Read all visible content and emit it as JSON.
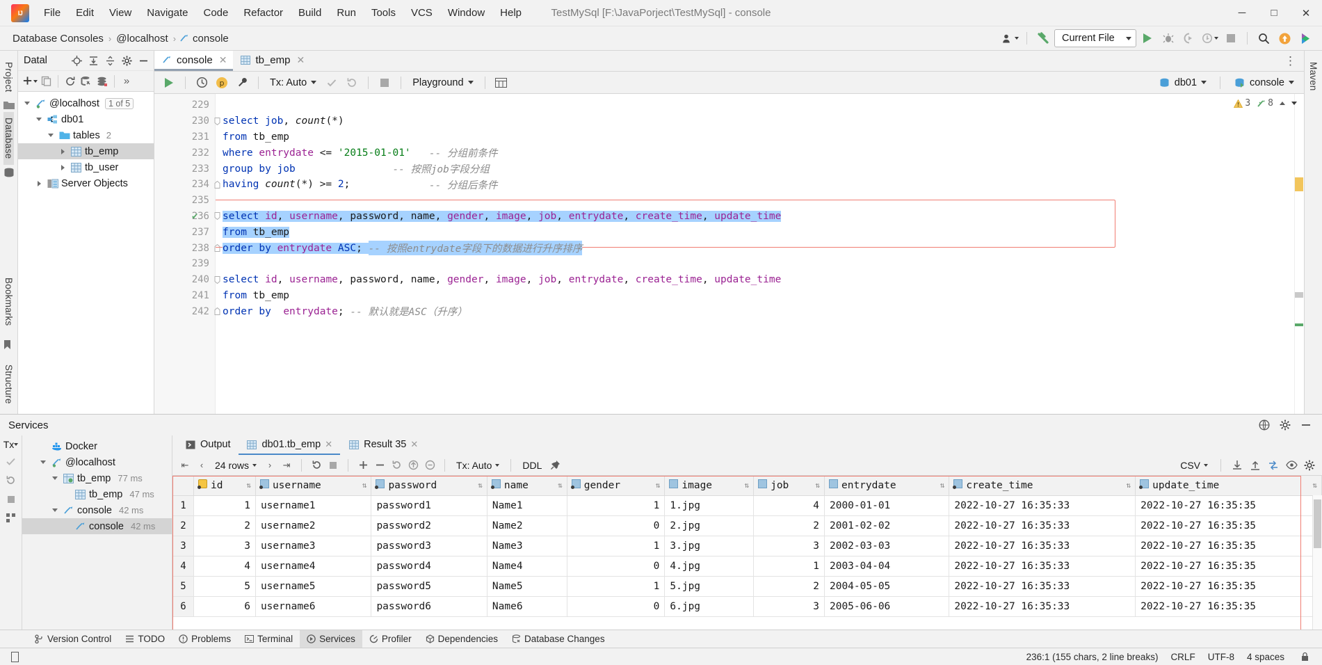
{
  "window": {
    "title": "TestMySql [F:\\JavaPorject\\TestMySql] - console",
    "minimize": "─",
    "maximize": "□",
    "close": "✕"
  },
  "menu": [
    {
      "label": "File"
    },
    {
      "label": "Edit"
    },
    {
      "label": "View"
    },
    {
      "label": "Navigate"
    },
    {
      "label": "Code"
    },
    {
      "label": "Refactor"
    },
    {
      "label": "Build"
    },
    {
      "label": "Run"
    },
    {
      "label": "Tools"
    },
    {
      "label": "VCS"
    },
    {
      "label": "Window"
    },
    {
      "label": "Help"
    }
  ],
  "breadcrumb": {
    "items": [
      "Database Consoles",
      "@localhost",
      "console"
    ],
    "separator": "›"
  },
  "navbar_right": {
    "run_config": "Current File"
  },
  "left_strip": {
    "project": "Project",
    "database": "Database"
  },
  "right_strip": {
    "maven": "Maven"
  },
  "bookmarks_strip": {
    "bookmarks": "Bookmarks",
    "structure": "Structure"
  },
  "db_panel": {
    "title": "Datal",
    "tree": [
      {
        "label": "@localhost",
        "badge": "1 of 5",
        "indent": 0,
        "expanded": true,
        "icon": "connection-icon"
      },
      {
        "label": "db01",
        "indent": 1,
        "expanded": true,
        "icon": "schema-icon"
      },
      {
        "label": "tables",
        "count": "2",
        "indent": 2,
        "expanded": true,
        "icon": "folder-icon"
      },
      {
        "label": "tb_emp",
        "indent": 3,
        "expanded": false,
        "icon": "table-icon",
        "selected": true
      },
      {
        "label": "tb_user",
        "indent": 3,
        "expanded": false,
        "icon": "table-icon"
      },
      {
        "label": "Server Objects",
        "indent": 1,
        "expanded": false,
        "icon": "server-objects-icon"
      }
    ]
  },
  "editor_tabs": [
    {
      "label": "console",
      "icon": "console-icon",
      "active": true
    },
    {
      "label": "tb_emp",
      "icon": "table-icon",
      "active": false
    }
  ],
  "sql_toolbar": {
    "tx_mode": "Tx: Auto",
    "schema": "Playground",
    "data_source": "db01",
    "session": "console"
  },
  "inspections": {
    "warnings": "3",
    "weak_warnings": "8"
  },
  "editor": {
    "lines": [
      {
        "num": "229",
        "tokens": []
      },
      {
        "num": "230",
        "fold": "start",
        "tokens": [
          {
            "t": "select",
            "c": "kw"
          },
          {
            "t": " ",
            "c": "pn"
          },
          {
            "t": "job",
            "c": "kw"
          },
          {
            "t": ", ",
            "c": "pn"
          },
          {
            "t": "count",
            "c": "fn"
          },
          {
            "t": "(*)",
            "c": "pn"
          }
        ]
      },
      {
        "num": "231",
        "tokens": [
          {
            "t": "from",
            "c": "kw"
          },
          {
            "t": " tb_emp",
            "c": "pn"
          }
        ]
      },
      {
        "num": "232",
        "tokens": [
          {
            "t": "where",
            "c": "kw"
          },
          {
            "t": " ",
            "c": "pn"
          },
          {
            "t": "entrydate",
            "c": "col"
          },
          {
            "t": " <= ",
            "c": "pn"
          },
          {
            "t": "'2015-01-01'",
            "c": "str"
          },
          {
            "t": "   ",
            "c": "pn"
          },
          {
            "t": "-- 分组前条件",
            "c": "cmt"
          }
        ]
      },
      {
        "num": "233",
        "tokens": [
          {
            "t": "group by",
            "c": "kw"
          },
          {
            "t": " job",
            "c": "kw"
          },
          {
            "t": "                ",
            "c": "pn"
          },
          {
            "t": "-- 按照job字段分组",
            "c": "cmt"
          }
        ]
      },
      {
        "num": "234",
        "fold": "end",
        "tokens": [
          {
            "t": "having",
            "c": "kw"
          },
          {
            "t": " ",
            "c": "pn"
          },
          {
            "t": "count",
            "c": "fn"
          },
          {
            "t": "(*) >= ",
            "c": "pn"
          },
          {
            "t": "2",
            "c": "num"
          },
          {
            "t": ";",
            "c": "pn"
          },
          {
            "t": "             ",
            "c": "pn"
          },
          {
            "t": "-- 分组后条件",
            "c": "cmt"
          }
        ]
      },
      {
        "num": "235",
        "tokens": []
      },
      {
        "num": "236",
        "gutter_mark": "✔",
        "fold": "start",
        "selected": true,
        "tokens": [
          {
            "t": "select",
            "c": "kw"
          },
          {
            "t": " ",
            "c": "pn"
          },
          {
            "t": "id",
            "c": "col"
          },
          {
            "t": ", ",
            "c": "pn"
          },
          {
            "t": "username",
            "c": "col"
          },
          {
            "t": ", ",
            "c": "pn"
          },
          {
            "t": "password",
            "c": "pn"
          },
          {
            "t": ", ",
            "c": "pn"
          },
          {
            "t": "name",
            "c": "pn"
          },
          {
            "t": ", ",
            "c": "pn"
          },
          {
            "t": "gender",
            "c": "col"
          },
          {
            "t": ", ",
            "c": "pn"
          },
          {
            "t": "image",
            "c": "col"
          },
          {
            "t": ", ",
            "c": "pn"
          },
          {
            "t": "job",
            "c": "col"
          },
          {
            "t": ", ",
            "c": "pn"
          },
          {
            "t": "entrydate",
            "c": "col"
          },
          {
            "t": ", ",
            "c": "pn"
          },
          {
            "t": "create_time",
            "c": "col"
          },
          {
            "t": ", ",
            "c": "pn"
          },
          {
            "t": "update_time",
            "c": "col"
          }
        ]
      },
      {
        "num": "237",
        "selected": true,
        "tokens": [
          {
            "t": "from",
            "c": "kw"
          },
          {
            "t": " tb_emp",
            "c": "pn"
          }
        ]
      },
      {
        "num": "238",
        "fold": "end",
        "selected": true,
        "tokens": [
          {
            "t": "order by",
            "c": "kw"
          },
          {
            "t": " ",
            "c": "pn"
          },
          {
            "t": "entrydate",
            "c": "col"
          },
          {
            "t": " ",
            "c": "pn"
          },
          {
            "t": "ASC",
            "c": "kw"
          },
          {
            "t": "; ",
            "c": "pn"
          },
          {
            "t": "-- 按照entrydate字段下的数据进行升序排序",
            "c": "cmt"
          }
        ]
      },
      {
        "num": "239",
        "tokens": []
      },
      {
        "num": "240",
        "fold": "start",
        "tokens": [
          {
            "t": "select",
            "c": "kw"
          },
          {
            "t": " ",
            "c": "pn"
          },
          {
            "t": "id",
            "c": "col"
          },
          {
            "t": ", ",
            "c": "pn"
          },
          {
            "t": "username",
            "c": "col"
          },
          {
            "t": ", ",
            "c": "pn"
          },
          {
            "t": "password",
            "c": "pn"
          },
          {
            "t": ", ",
            "c": "pn"
          },
          {
            "t": "name",
            "c": "pn"
          },
          {
            "t": ", ",
            "c": "pn"
          },
          {
            "t": "gender",
            "c": "col"
          },
          {
            "t": ", ",
            "c": "pn"
          },
          {
            "t": "image",
            "c": "col"
          },
          {
            "t": ", ",
            "c": "pn"
          },
          {
            "t": "job",
            "c": "col"
          },
          {
            "t": ", ",
            "c": "pn"
          },
          {
            "t": "entrydate",
            "c": "col"
          },
          {
            "t": ", ",
            "c": "pn"
          },
          {
            "t": "create_time",
            "c": "col"
          },
          {
            "t": ", ",
            "c": "pn"
          },
          {
            "t": "update_time",
            "c": "col"
          }
        ]
      },
      {
        "num": "241",
        "tokens": [
          {
            "t": "from",
            "c": "kw"
          },
          {
            "t": " tb_emp",
            "c": "pn"
          }
        ]
      },
      {
        "num": "242",
        "fold": "end",
        "tokens": [
          {
            "t": "order by",
            "c": "kw"
          },
          {
            "t": "  ",
            "c": "pn"
          },
          {
            "t": "entrydate",
            "c": "col"
          },
          {
            "t": "; ",
            "c": "pn"
          },
          {
            "t": "-- 默认就是ASC（升序）",
            "c": "cmt"
          }
        ]
      }
    ]
  },
  "services": {
    "title": "Services",
    "tree": [
      {
        "label": "Docker",
        "indent": 1,
        "icon": "docker-icon"
      },
      {
        "label": "@localhost",
        "indent": 1,
        "expanded": true,
        "icon": "connection-icon"
      },
      {
        "label": "tb_emp",
        "time": "77 ms",
        "indent": 2,
        "expanded": true,
        "icon": "query-icon"
      },
      {
        "label": "tb_emp",
        "time": "47 ms",
        "indent": 3,
        "icon": "table-icon"
      },
      {
        "label": "console",
        "time": "42 ms",
        "indent": 2,
        "expanded": true,
        "icon": "console-icon"
      },
      {
        "label": "console",
        "time": "42 ms",
        "indent": 3,
        "icon": "console-icon",
        "selected": true
      }
    ],
    "tabs": [
      {
        "label": "Output",
        "icon": "output-icon",
        "closable": false,
        "active": false
      },
      {
        "label": "db01.tb_emp",
        "icon": "table-icon",
        "closable": true,
        "active": true
      },
      {
        "label": "Result 35",
        "icon": "table-icon",
        "closable": true,
        "active": false
      }
    ],
    "grid_toolbar": {
      "rows": "24 rows",
      "tx_mode": "Tx: Auto",
      "ddl": "DDL",
      "format": "CSV"
    }
  },
  "result_grid": {
    "columns": [
      {
        "name": "id",
        "icon": "primary-key-icon",
        "align": "right"
      },
      {
        "name": "username",
        "icon": "column-icon",
        "align": "left"
      },
      {
        "name": "password",
        "icon": "column-icon",
        "align": "left"
      },
      {
        "name": "name",
        "icon": "column-icon",
        "align": "left"
      },
      {
        "name": "gender",
        "icon": "column-icon",
        "align": "right"
      },
      {
        "name": "image",
        "icon": "column-icon",
        "align": "left"
      },
      {
        "name": "job",
        "icon": "column-icon",
        "align": "right"
      },
      {
        "name": "entrydate",
        "icon": "column-icon",
        "align": "left"
      },
      {
        "name": "create_time",
        "icon": "column-icon",
        "align": "left"
      },
      {
        "name": "update_time",
        "icon": "column-icon",
        "align": "left"
      }
    ],
    "rows": [
      {
        "n": "1",
        "cells": [
          "1",
          "username1",
          "password1",
          "Name1",
          "1",
          "1.jpg",
          "4",
          "2000-01-01",
          "2022-10-27 16:35:33",
          "2022-10-27 16:35:35"
        ]
      },
      {
        "n": "2",
        "cells": [
          "2",
          "username2",
          "password2",
          "Name2",
          "0",
          "2.jpg",
          "2",
          "2001-02-02",
          "2022-10-27 16:35:33",
          "2022-10-27 16:35:35"
        ]
      },
      {
        "n": "3",
        "cells": [
          "3",
          "username3",
          "password3",
          "Name3",
          "1",
          "3.jpg",
          "3",
          "2002-03-03",
          "2022-10-27 16:35:33",
          "2022-10-27 16:35:35"
        ]
      },
      {
        "n": "4",
        "cells": [
          "4",
          "username4",
          "password4",
          "Name4",
          "0",
          "4.jpg",
          "1",
          "2003-04-04",
          "2022-10-27 16:35:33",
          "2022-10-27 16:35:35"
        ]
      },
      {
        "n": "5",
        "cells": [
          "5",
          "username5",
          "password5",
          "Name5",
          "1",
          "5.jpg",
          "2",
          "2004-05-05",
          "2022-10-27 16:35:33",
          "2022-10-27 16:35:35"
        ]
      },
      {
        "n": "6",
        "cells": [
          "6",
          "username6",
          "password6",
          "Name6",
          "0",
          "6.jpg",
          "3",
          "2005-06-06",
          "2022-10-27 16:35:33",
          "2022-10-27 16:35:35"
        ]
      }
    ]
  },
  "tool_windows": [
    {
      "label": "Version Control",
      "icon": "vcs-icon",
      "active": false
    },
    {
      "label": "TODO",
      "icon": "todo-icon",
      "active": false
    },
    {
      "label": "Problems",
      "icon": "problems-icon",
      "active": false
    },
    {
      "label": "Terminal",
      "icon": "terminal-icon",
      "active": false
    },
    {
      "label": "Services",
      "icon": "services-icon",
      "active": true
    },
    {
      "label": "Profiler",
      "icon": "profiler-icon",
      "active": false
    },
    {
      "label": "Dependencies",
      "icon": "dependencies-icon",
      "active": false
    },
    {
      "label": "Database Changes",
      "icon": "db-changes-icon",
      "active": false
    }
  ],
  "status_bar": {
    "caret": "236:1 (155 chars, 2 line breaks)",
    "line_sep": "CRLF",
    "encoding": "UTF-8",
    "indent": "4 spaces"
  },
  "colors": {
    "accent_blue": "#4a89c8",
    "selection": "#a6d2ff",
    "highlight_border": "#f07d72",
    "run_green": "#59a869",
    "keyword": "#0033b3",
    "column": "#9b2393",
    "string": "#067d17",
    "comment": "#8c8c8c"
  }
}
